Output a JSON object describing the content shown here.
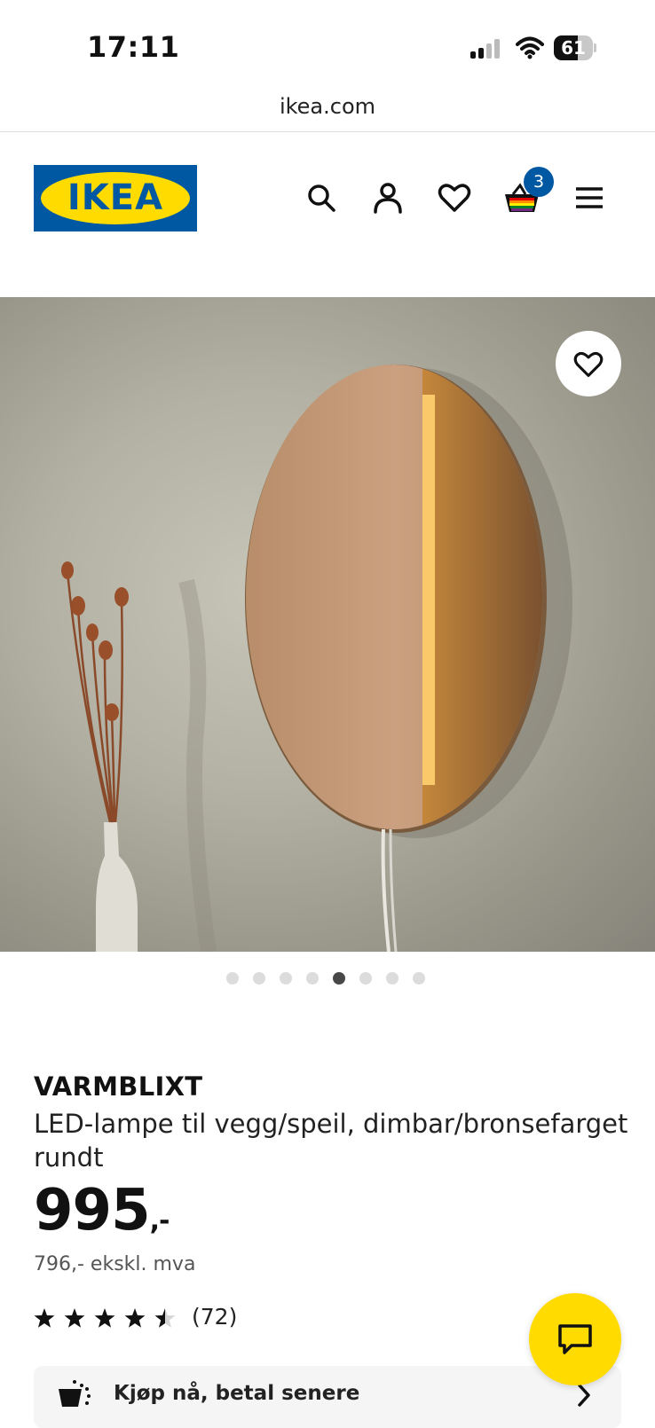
{
  "status_bar": {
    "time": "17:11",
    "battery": "61",
    "battery_level": 0.61
  },
  "browser": {
    "url": "ikea.com"
  },
  "header": {
    "logo_text": "IKEA",
    "cart_count": "3",
    "icons": [
      "search-icon",
      "account-icon",
      "heart-icon",
      "cart-icon",
      "menu-icon"
    ]
  },
  "gallery": {
    "image_count": 8,
    "active_index": 4
  },
  "product": {
    "name": "VARMBLIXT",
    "description": "LED-lampe til vegg/speil, dimbar/bronsefarget rundt",
    "price": "995",
    "price_suffix": ",-",
    "price_ex_vat": "796,- ekskl. mva",
    "rating": 4.5,
    "rating_count": "(72)"
  },
  "bnpl": {
    "label": "Kjøp nå, betal senere"
  },
  "colors": {
    "brand_blue": "#0058a3",
    "brand_yellow": "#ffdb00",
    "text": "#111111"
  }
}
